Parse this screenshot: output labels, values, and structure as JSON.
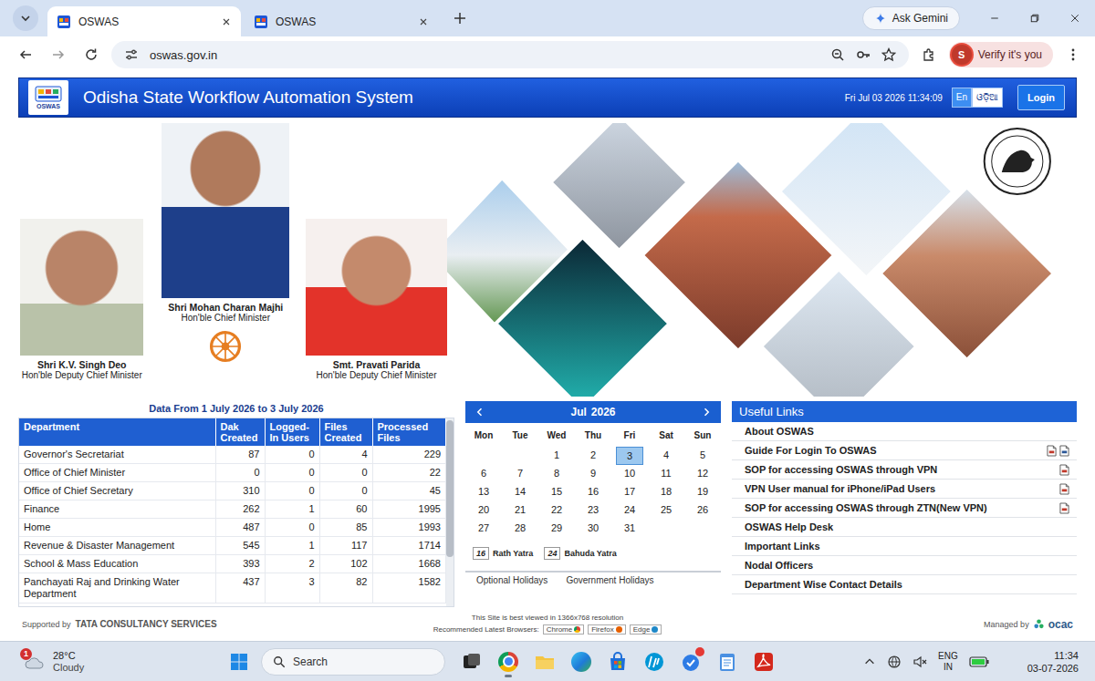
{
  "browser": {
    "tabs": [
      {
        "label": "OSWAS",
        "selected": true
      },
      {
        "label": "OSWAS",
        "selected": false
      }
    ],
    "gemini": "Ask Gemini",
    "url": "oswas.gov.in",
    "profile": {
      "avatar": "S",
      "label": "Verify it's you"
    }
  },
  "header": {
    "logo": "OSWAS",
    "title": "Odisha State Workflow Automation System",
    "datetime": "Fri Jul 03 2026 11:34:09",
    "languages": [
      {
        "label": "En",
        "selected": true
      },
      {
        "label": "ଓଡ଼ିଆ",
        "selected": false
      }
    ],
    "login": "Login"
  },
  "leaders": [
    {
      "name": "Shri K.V. Singh Deo",
      "role": "Hon'ble Deputy Chief Minister"
    },
    {
      "name": "Shri Mohan Charan Majhi",
      "role": "Hon'ble Chief Minister"
    },
    {
      "name": "Smt. Pravati Parida",
      "role": "Hon'ble Deputy Chief Minister"
    }
  ],
  "stats": {
    "title": "Data From 1 July 2026 to 3 July 2026",
    "columns": [
      "Department",
      "Dak Created",
      "Logged-In Users",
      "Files Created",
      "Processed Files"
    ],
    "rows": [
      [
        "Governor's Secretariat",
        "87",
        "0",
        "4",
        "229"
      ],
      [
        "Office of Chief Minister",
        "0",
        "0",
        "0",
        "22"
      ],
      [
        "Office of Chief Secretary",
        "310",
        "0",
        "0",
        "45"
      ],
      [
        "Finance",
        "262",
        "1",
        "60",
        "1995"
      ],
      [
        "Home",
        "487",
        "0",
        "85",
        "1993"
      ],
      [
        "Revenue & Disaster Management",
        "545",
        "1",
        "117",
        "1714"
      ],
      [
        "School & Mass Education",
        "393",
        "2",
        "102",
        "1668"
      ],
      [
        "Panchayati Raj and Drinking Water Department",
        "437",
        "3",
        "82",
        "1582"
      ]
    ]
  },
  "calendar": {
    "month": "Jul",
    "year": "2026",
    "weekdays": [
      "Mon",
      "Tue",
      "Wed",
      "Thu",
      "Fri",
      "Sat",
      "Sun"
    ],
    "weeks": [
      [
        {
          "day": "",
          "selected": false
        },
        {
          "day": "",
          "selected": false
        },
        {
          "day": "1",
          "selected": false
        },
        {
          "day": "2",
          "selected": false
        },
        {
          "day": "3",
          "selected": true
        },
        {
          "day": "4",
          "selected": false
        },
        {
          "day": "5",
          "selected": false
        }
      ],
      [
        {
          "day": "6",
          "selected": false
        },
        {
          "day": "7",
          "selected": false
        },
        {
          "day": "8",
          "selected": false
        },
        {
          "day": "9",
          "selected": false
        },
        {
          "day": "10",
          "selected": false
        },
        {
          "day": "11",
          "selected": false
        },
        {
          "day": "12",
          "selected": false
        }
      ],
      [
        {
          "day": "13",
          "selected": false
        },
        {
          "day": "14",
          "selected": false
        },
        {
          "day": "15",
          "selected": false
        },
        {
          "day": "16",
          "selected": false
        },
        {
          "day": "17",
          "selected": false
        },
        {
          "day": "18",
          "selected": false
        },
        {
          "day": "19",
          "selected": false
        }
      ],
      [
        {
          "day": "20",
          "selected": false
        },
        {
          "day": "21",
          "selected": false
        },
        {
          "day": "22",
          "selected": false
        },
        {
          "day": "23",
          "selected": false
        },
        {
          "day": "24",
          "selected": false
        },
        {
          "day": "25",
          "selected": false
        },
        {
          "day": "26",
          "selected": false
        }
      ],
      [
        {
          "day": "27",
          "selected": false
        },
        {
          "day": "28",
          "selected": false
        },
        {
          "day": "29",
          "selected": false
        },
        {
          "day": "30",
          "selected": false
        },
        {
          "day": "31",
          "selected": false
        }
      ]
    ],
    "events": [
      {
        "day": "16",
        "label": "Rath Yatra"
      },
      {
        "day": "24",
        "label": "Bahuda Yatra"
      }
    ],
    "tabs": [
      {
        "label": "Optional Holidays",
        "selected": false
      },
      {
        "label": "Government Holidays",
        "selected": false
      }
    ]
  },
  "links": {
    "title": "Useful Links",
    "items": [
      {
        "label": "About OSWAS",
        "kind": "plain"
      },
      {
        "label": "Guide For Login To OSWAS",
        "kind": "pdf-doc"
      },
      {
        "label": "SOP for accessing OSWAS through VPN",
        "kind": "pdf"
      },
      {
        "label": "VPN User manual for iPhone/iPad Users",
        "kind": "pdf"
      },
      {
        "label": "SOP for accessing OSWAS through ZTN(New VPN)",
        "kind": "pdf"
      },
      {
        "label": "OSWAS Help Desk",
        "kind": "plain"
      },
      {
        "label": "Important Links",
        "kind": "plain"
      },
      {
        "label": "Nodal Officers",
        "kind": "plain"
      },
      {
        "label": "Department Wise Contact Details",
        "kind": "plain"
      }
    ]
  },
  "footer": {
    "supported_by": "Supported by",
    "vendor": "TATA CONSULTANCY SERVICES",
    "resolution_note": "This Site is best viewed in 1366x768 resolution",
    "browsers_label": "Recommended Latest Browsers:",
    "browsers": [
      "Chrome",
      "Firefox",
      "Edge"
    ],
    "managed_by": "Managed by",
    "manager": "ocac"
  },
  "taskbar": {
    "weather": {
      "badge": "1",
      "temperature": "28°C",
      "condition": "Cloudy"
    },
    "search": "Search",
    "apps": [
      {
        "kind": "taskview",
        "running": false,
        "alert": false
      },
      {
        "kind": "chrome",
        "running": true,
        "alert": false
      },
      {
        "kind": "explorer",
        "running": false,
        "alert": false
      },
      {
        "kind": "edge",
        "running": false,
        "alert": false
      },
      {
        "kind": "store",
        "running": false,
        "alert": false
      },
      {
        "kind": "hp",
        "running": false,
        "alert": false
      },
      {
        "kind": "update",
        "running": false,
        "alert": true
      },
      {
        "kind": "notepad",
        "running": false,
        "alert": false
      },
      {
        "kind": "acrobat",
        "running": false,
        "alert": false
      }
    ],
    "tray": {
      "language": "ENG",
      "region": "IN",
      "time": "11:34",
      "date": "03-07-2026"
    }
  }
}
